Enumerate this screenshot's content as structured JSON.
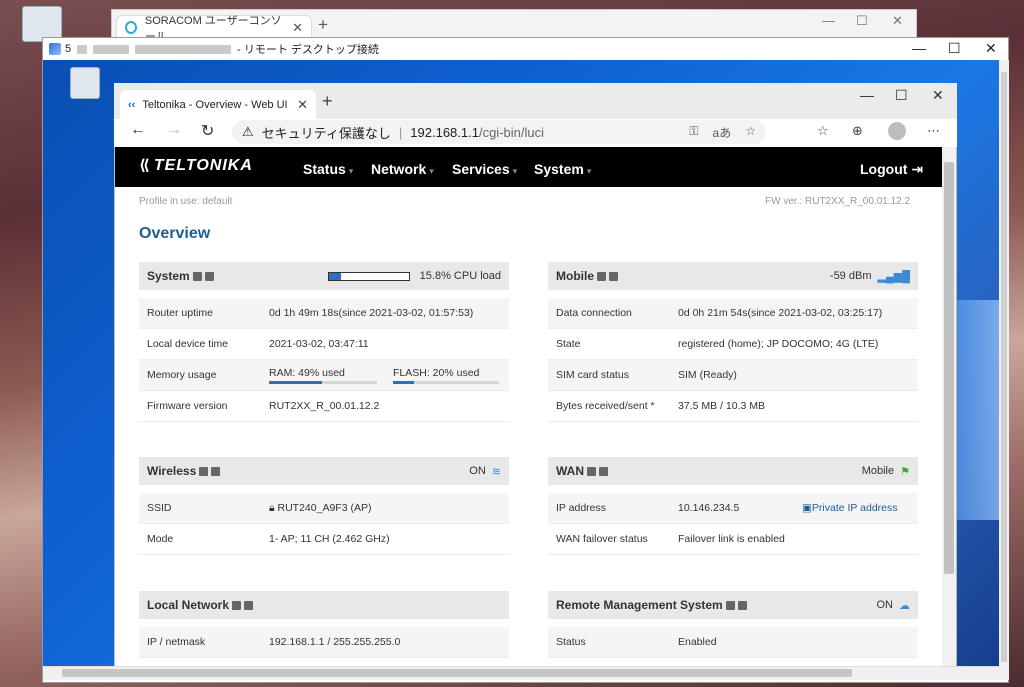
{
  "outer": {
    "back_tab_title": "SORACOM ユーザーコンソール",
    "rdp_title": "- リモート デスクトップ接続",
    "rdp_title_prefix": "5"
  },
  "browser": {
    "tab_title": "Teltonika - Overview - Web UI",
    "security_warning": "セキュリティ保護なし",
    "url_host": "192.168.1.1",
    "url_path": "/cgi-bin/luci",
    "reader_label": "aあ"
  },
  "nav": {
    "brand": "TELTONIKA",
    "menu": [
      "Status",
      "Network",
      "Services",
      "System"
    ],
    "logout": "Logout"
  },
  "page": {
    "profile": "Profile in use: default",
    "fw": "FW ver.: RUT2XX_R_00.01.12.2",
    "title": "Overview"
  },
  "system": {
    "title": "System",
    "cpu_label": "15.8% CPU load",
    "cpu_load": 0.158,
    "rows": [
      {
        "k": "Router uptime",
        "v": "0d 1h 49m 18s(since 2021-03-02, 01:57:53)"
      },
      {
        "k": "Local device time",
        "v": "2021-03-02, 03:47:11"
      },
      {
        "k": "Memory usage",
        "ram": "RAM: 49% used",
        "flash": "FLASH: 20% used",
        "ram_frac": 0.49,
        "flash_frac": 0.2
      },
      {
        "k": "Firmware version",
        "v": "RUT2XX_R_00.01.12.2"
      }
    ]
  },
  "mobile": {
    "title": "Mobile",
    "signal": "-59 dBm",
    "rows": [
      {
        "k": "Data connection",
        "v": "0d 0h 21m 54s(since 2021-03-02, 03:25:17)"
      },
      {
        "k": "State",
        "v": "registered (home); JP DOCOMO; 4G (LTE)"
      },
      {
        "k": "SIM card status",
        "v": "SIM (Ready)"
      },
      {
        "k": "Bytes received/sent *",
        "v": "37.5 MB / 10.3 MB"
      }
    ]
  },
  "wireless": {
    "title": "Wireless",
    "state": "ON",
    "rows": [
      {
        "k": "SSID",
        "v": "RUT240_A9F3 (AP)"
      },
      {
        "k": "Mode",
        "v": "1- AP; 11 CH (2.462 GHz)"
      }
    ]
  },
  "wan": {
    "title": "WAN",
    "state": "Mobile",
    "rows": [
      {
        "k": "IP address",
        "v": "10.146.234.5",
        "extra": "Private IP address"
      },
      {
        "k": "WAN failover status",
        "v": "Failover link is enabled"
      }
    ]
  },
  "lan": {
    "title": "Local Network",
    "rows": [
      {
        "k": "IP / netmask",
        "v": "192.168.1.1 / 255.255.255.0"
      }
    ]
  },
  "rms": {
    "title": "Remote Management System",
    "state": "ON",
    "rows": [
      {
        "k": "Status",
        "v": "Enabled"
      }
    ]
  },
  "colors": {
    "accent": "#1f5d95",
    "bar": "#2f6dbf",
    "nav_bg": "#000000"
  }
}
